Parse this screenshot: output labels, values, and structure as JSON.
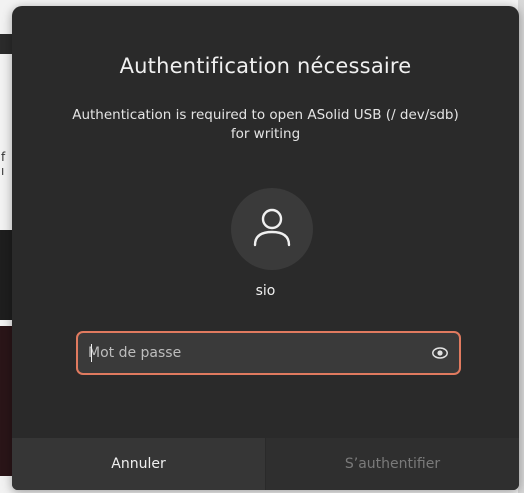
{
  "dialog": {
    "title": "Authentification nécessaire",
    "message": "Authentication is required to open ASolid USB (/ dev/sdb) for writing",
    "username": "sio",
    "password_placeholder": "Mot de passe",
    "cancel_label": "Annuler",
    "authenticate_label": "S’authentifier"
  },
  "background": {
    "glyphs": "f\nı"
  },
  "icons": {
    "avatar": "user-icon",
    "reveal": "eye-icon"
  },
  "colors": {
    "dialog_bg": "#2a2a2a",
    "field_border": "#e07a5f",
    "disabled_text": "#7a7a7a"
  }
}
